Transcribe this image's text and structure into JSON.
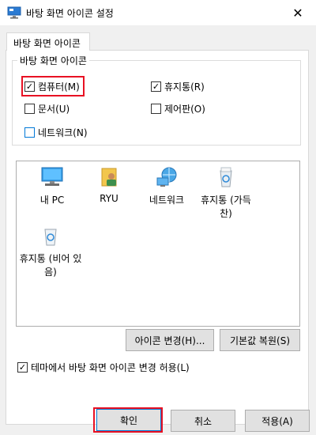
{
  "window": {
    "title": "바탕 화면 아이콘 설정",
    "close_label": "✕"
  },
  "tab": {
    "label": "바탕 화면 아이콘"
  },
  "group": {
    "label": "바탕 화면 아이콘",
    "checkboxes": [
      {
        "label": "컴퓨터(M)",
        "checked": true
      },
      {
        "label": "휴지통(R)",
        "checked": true
      },
      {
        "label": "문서(U)",
        "checked": false
      },
      {
        "label": "제어판(O)",
        "checked": false
      },
      {
        "label": "네트워크(N)",
        "checked": false
      }
    ]
  },
  "icons": [
    {
      "label": "내 PC",
      "icon": "computer-icon"
    },
    {
      "label": "RYU",
      "icon": "user-folder-icon"
    },
    {
      "label": "네트워크",
      "icon": "network-icon"
    },
    {
      "label": "휴지통 (가득 찬)",
      "icon": "recycle-bin-full-icon"
    },
    {
      "label": "휴지통 (비어 있음)",
      "icon": "recycle-bin-empty-icon"
    }
  ],
  "buttons": {
    "change_icon": "아이콘 변경(H)...",
    "restore_default": "기본값 복원(S)",
    "ok": "확인",
    "cancel": "취소",
    "apply": "적용(A)"
  },
  "theme_option": {
    "label": "테마에서 바탕 화면 아이콘 변경 허용(L)",
    "checked": true
  },
  "colors": {
    "highlight": "#e81123",
    "accent": "#0078d7"
  }
}
